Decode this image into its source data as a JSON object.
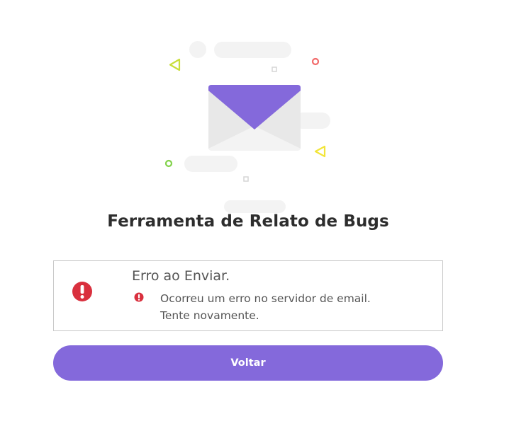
{
  "page": {
    "title": "Ferramenta de Relato de Bugs"
  },
  "illustration": {
    "icon": "envelope-icon",
    "accent_color": "#8469db"
  },
  "alert": {
    "heading": "Erro ao Enviar.",
    "message_line1": "Ocorreu um erro no servidor de email.",
    "message_line2": "Tente novamente.",
    "icon": "error-icon",
    "color": "#d9303e"
  },
  "actions": {
    "back_label": "Voltar",
    "button_color": "#8469db"
  }
}
